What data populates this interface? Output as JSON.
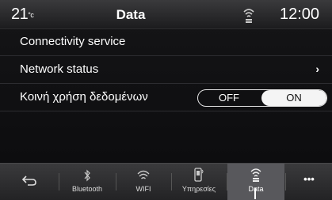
{
  "status": {
    "temperature": "21",
    "temp_unit": "°c",
    "title": "Data",
    "time": "12:00",
    "icon": "data-signal-icon"
  },
  "rows": [
    {
      "label": "Connectivity service"
    },
    {
      "label": "Network status",
      "chevron": "›"
    },
    {
      "label": "Κοινή χρήση δεδομένων",
      "toggle": {
        "off": "OFF",
        "on": "ON",
        "selected": "ON"
      }
    }
  ],
  "nav": [
    {
      "label": "",
      "icon": "back-icon"
    },
    {
      "label": "Bluetooth",
      "icon": "bluetooth-icon"
    },
    {
      "label": "WIFI",
      "icon": "wifi-icon"
    },
    {
      "label": "Υπηρεσίες",
      "icon": "services-icon"
    },
    {
      "label": "Data",
      "icon": "data-icon",
      "active": true
    },
    {
      "label": "•••",
      "icon": "more-icon"
    }
  ],
  "colors": {
    "accent": "#ffffff",
    "background": "#0d0d0f",
    "bar": "#3a3a3c"
  }
}
